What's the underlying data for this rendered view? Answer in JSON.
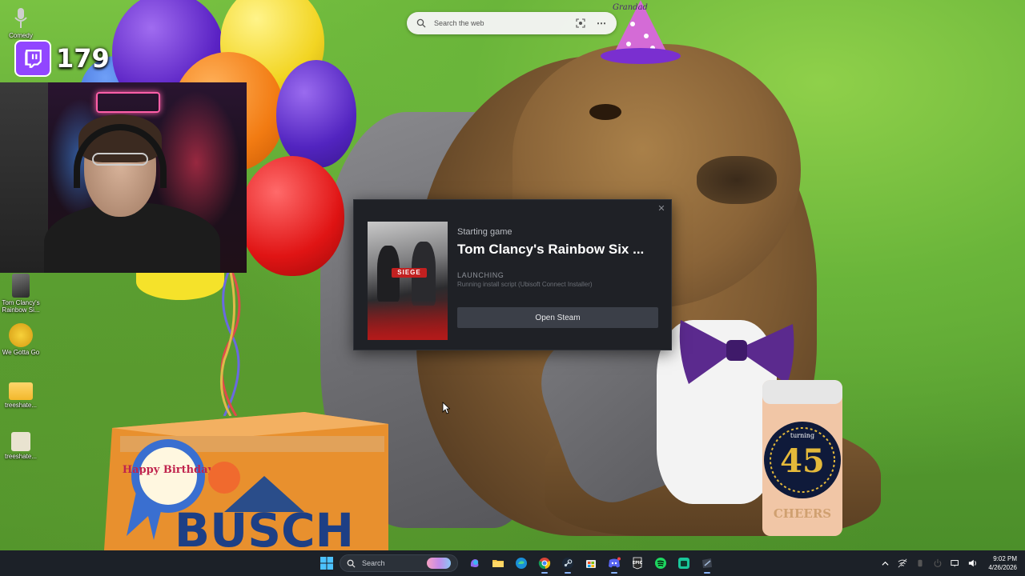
{
  "desktop": {
    "icons": [
      {
        "label": "Comedy"
      },
      {
        "label": "Tom Clancy's Rainbow Si..."
      },
      {
        "label": "We Gotta Go"
      },
      {
        "label": "treeshate..."
      },
      {
        "label": "treeshate..."
      }
    ]
  },
  "wallpaper": {
    "hat_text": "Grandad",
    "box_brand": "BUSCH",
    "box_badge": "Happy Birthday",
    "can_number": "45",
    "can_top": "turning",
    "can_bottom": "CHEERS"
  },
  "stream_overlay": {
    "viewer_count": "179",
    "icon": "twitch-icon"
  },
  "web_search": {
    "placeholder": "Search the web",
    "more": "⋯"
  },
  "steam_dialog": {
    "subtitle": "Starting game",
    "game_title": "Tom Clancy's Rainbow Six ...",
    "status": "LAUNCHING",
    "detail": "Running install script (Ubisoft Connect Installer)",
    "button": "Open Steam",
    "close": "✕",
    "cover_text": "SIEGE"
  },
  "taskbar": {
    "search_placeholder": "Search",
    "apps": [
      "start-icon",
      "copilot-icon",
      "file-explorer-icon",
      "edge-icon",
      "chrome-icon",
      "steam-icon",
      "ms-store-icon",
      "discord-icon",
      "epic-games-icon",
      "spotify-icon",
      "app-icon",
      "steam-running-icon"
    ],
    "clock_time": "9:02 PM",
    "clock_date": "4/26/2026"
  },
  "colors": {
    "steam_bg": "#1f2126",
    "steam_button": "#3b3f48",
    "twitch_purple": "#9146ff",
    "taskbar_bg": "#1c2128"
  }
}
